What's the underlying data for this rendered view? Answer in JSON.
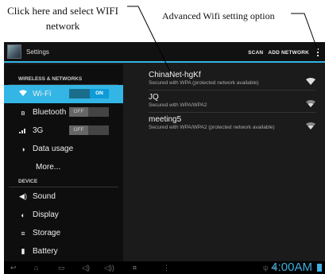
{
  "annotations": {
    "left": "Click here and select WIFI network",
    "right": "Advanced Wifi setting option"
  },
  "actionbar": {
    "title": "Settings",
    "scan_label": "SCAN",
    "add_network_label": "ADD NETWORK"
  },
  "sidebar": {
    "wireless_header": "WIRELESS & NETWORKS",
    "device_header": "DEVICE",
    "items": [
      {
        "label": "Wi-Fi",
        "toggle": "ON",
        "icon": "wifi-icon"
      },
      {
        "label": "Bluetooth",
        "toggle": "OFF",
        "icon": "bluetooth-icon"
      },
      {
        "label": "3G",
        "toggle": "OFF",
        "icon": "signal-icon"
      },
      {
        "label": "Data usage",
        "icon": "data-usage-icon"
      },
      {
        "label": "More...",
        "icon": ""
      },
      {
        "label": "Sound",
        "icon": "speaker-icon"
      },
      {
        "label": "Display",
        "icon": "display-icon"
      },
      {
        "label": "Storage",
        "icon": "storage-icon"
      },
      {
        "label": "Battery",
        "icon": "battery-icon"
      }
    ]
  },
  "networks": [
    {
      "ssid": "ChinaNet-hgKf",
      "security": "Secured with WPA (protected network available)"
    },
    {
      "ssid": "JQ",
      "security": "Secured with WPA/WPA2"
    },
    {
      "ssid": "meeting5",
      "security": "Secured with WPA/WPA2 (protected network available)"
    }
  ],
  "statusbar": {
    "time": "4:00AM"
  },
  "colors": {
    "accent": "#33b5e5",
    "clock": "#3fb0e0"
  }
}
